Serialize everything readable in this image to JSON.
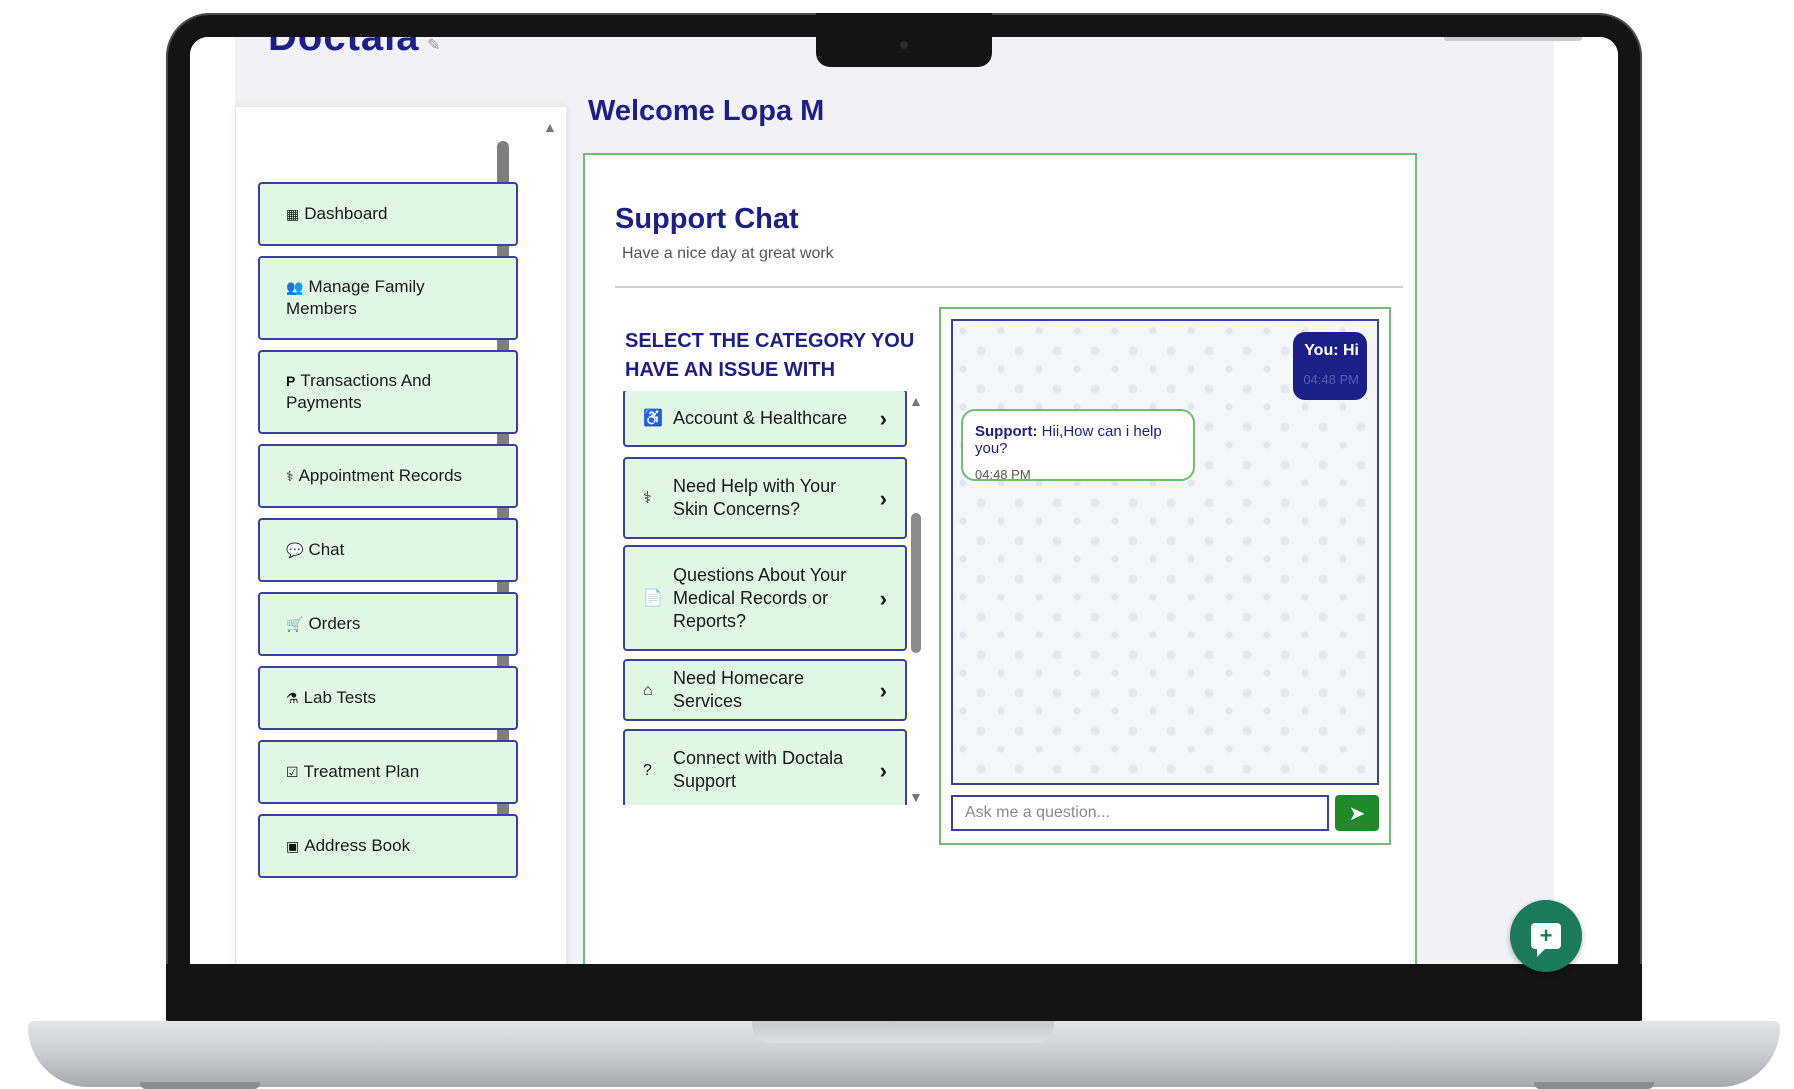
{
  "app": {
    "logo": "Doctala"
  },
  "header": {
    "welcome": "Welcome Lopa M"
  },
  "sidebar": {
    "items": [
      {
        "label": "Dashboard",
        "icon": "dashboard-icon",
        "glyph": "▦"
      },
      {
        "label": "Manage Family Members",
        "icon": "users-icon",
        "glyph": "👥"
      },
      {
        "label": "Transactions And Payments",
        "icon": "paypal-icon",
        "glyph": "P"
      },
      {
        "label": "Appointment Records",
        "icon": "doctor-icon",
        "glyph": "⚕"
      },
      {
        "label": "Chat",
        "icon": "comments-icon",
        "glyph": "💬"
      },
      {
        "label": "Orders",
        "icon": "cart-icon",
        "glyph": "🛒"
      },
      {
        "label": "Lab Tests",
        "icon": "flask-icon",
        "glyph": "⚗"
      },
      {
        "label": "Treatment Plan",
        "icon": "checkbox-icon",
        "glyph": "☑"
      },
      {
        "label": "Address Book",
        "icon": "address-book-icon",
        "glyph": "▣"
      }
    ]
  },
  "support": {
    "title": "Support Chat",
    "subtitle": "Have a nice day at great work",
    "category_heading": "SELECT THE CATEGORY YOU HAVE AN ISSUE WITH",
    "categories": [
      {
        "label": "Account & Healthcare",
        "icon": "accessibility-icon",
        "glyph": "♿"
      },
      {
        "label": "Need Help with Your Skin Concerns?",
        "icon": "doctor-icon",
        "glyph": "⚕"
      },
      {
        "label": "Questions About Your Medical Records or Reports?",
        "icon": "file-icon",
        "glyph": "📄"
      },
      {
        "label": "Need Homecare Services",
        "icon": "home-icon",
        "glyph": "⌂"
      },
      {
        "label": "Connect with Doctala Support",
        "icon": "question-icon",
        "glyph": "?"
      }
    ]
  },
  "chat": {
    "messages": [
      {
        "sender": "You:",
        "text": "Hi",
        "time": "04:48 PM"
      },
      {
        "sender": "Support:",
        "text": "Hii,How can i help you?",
        "time": "04:48 PM"
      }
    ],
    "input_placeholder": "Ask me a question..."
  },
  "colors": {
    "brand": "#1c1f87",
    "accent_green": "#6fbf73",
    "item_bg": "#e1f6e3",
    "send_button": "#1f8a2a"
  }
}
